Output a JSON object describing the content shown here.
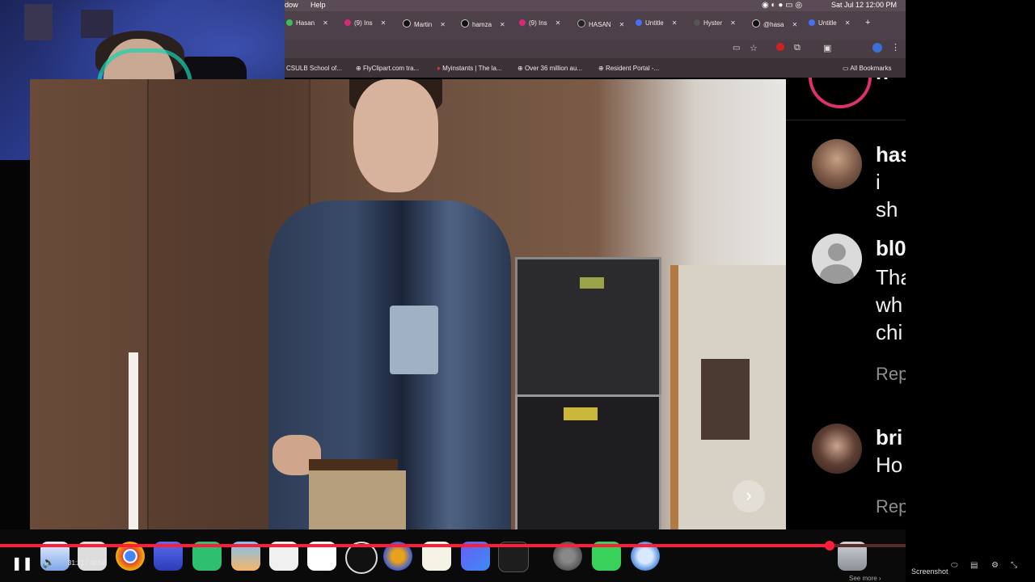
{
  "menubar": {
    "items": [
      "dow",
      "Help"
    ],
    "clock": "Sat Jul 12  12:00 PM"
  },
  "tabs": [
    {
      "label": "Hasan",
      "color": "#3cbd5e"
    },
    {
      "label": "(9) Ins",
      "color": "#d62976"
    },
    {
      "label": "Martin",
      "color": "#111111"
    },
    {
      "label": "hamza",
      "color": "#111111"
    },
    {
      "label": "(9) Ins",
      "color": "#d62976"
    },
    {
      "label": "HASAN",
      "color": "#222222"
    },
    {
      "label": "Untitle",
      "color": "#4a6cf7"
    },
    {
      "label": "Hyster",
      "color": "#555555"
    },
    {
      "label": "@hasa",
      "color": "#111111"
    },
    {
      "label": "Untitle",
      "color": "#4a6cf7"
    }
  ],
  "new_tab": "+",
  "bookmarks": [
    {
      "label": "CSULB School of..."
    },
    {
      "label": "FlyClipart.com tra..."
    },
    {
      "label": "Myinstants | The la..."
    },
    {
      "label": "Over 36 million au..."
    },
    {
      "label": "Resident Portal -..."
    }
  ],
  "all_bookmarks": "All Bookmarks",
  "comments": [
    {
      "name": "has",
      "text": "i sh",
      "reply": ""
    },
    {
      "name": "bl0",
      "text": "Tha\nwh\nchi",
      "reply": "Rep"
    },
    {
      "name": "bri",
      "text": "Ho",
      "reply": "Rep"
    }
  ],
  "partial_top_name": "h",
  "next_glyph": "›",
  "player": {
    "time": "31:21 / 38:50",
    "progress": 0.916,
    "see_more": "See more ›"
  },
  "screenshot_label": "Screenshot",
  "colors": {
    "progress": "#ff1e38",
    "reply_gray": "#8e8e8e",
    "story_ring": "#e1306c"
  }
}
